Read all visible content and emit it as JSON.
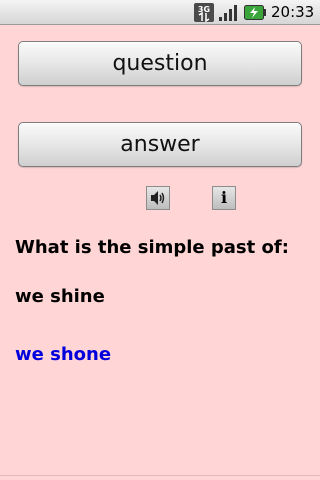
{
  "status_bar": {
    "time": "20:33",
    "network_label": "3G",
    "icons": [
      "3g-icon",
      "signal-icon",
      "battery-charging-icon"
    ]
  },
  "buttons": {
    "question_label": "question",
    "answer_label": "answer"
  },
  "tools": {
    "speaker_icon": "speaker-icon",
    "info_icon": "info-icon",
    "info_glyph": "i"
  },
  "content": {
    "prompt": "What is the simple past of:",
    "word": "we shine",
    "answer": "we shone"
  },
  "colors": {
    "background": "#ffd5d5",
    "answer_text": "#0000dd",
    "battery_fill": "#3aa53a"
  }
}
